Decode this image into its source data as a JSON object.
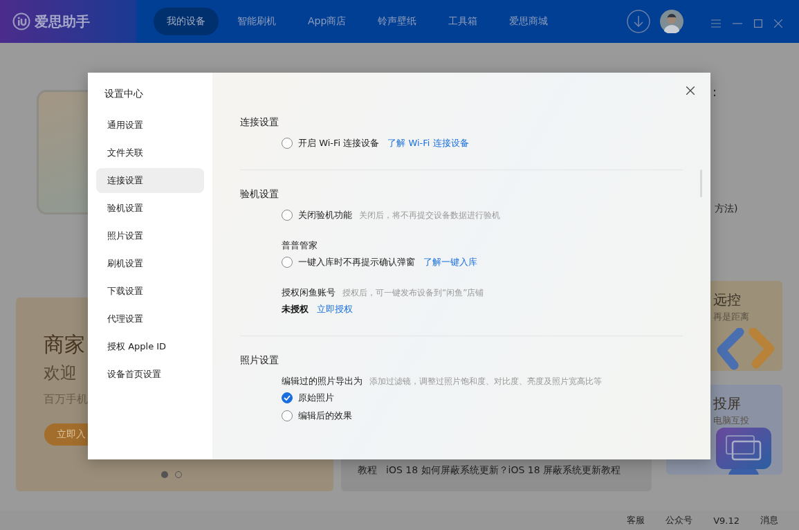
{
  "app": {
    "logo": "爱思助手",
    "nav": [
      {
        "label": "我的设备",
        "selected": true
      },
      {
        "label": "智能刷机",
        "selected": false
      },
      {
        "label": "App商店",
        "selected": false
      },
      {
        "label": "铃声壁纸",
        "selected": false
      },
      {
        "label": "工具箱",
        "selected": false
      },
      {
        "label": "爱思商城",
        "selected": false
      }
    ]
  },
  "background": {
    "device_panel": {
      "fragments": [
        ":",
        "方法)"
      ]
    },
    "promo_card": {
      "title": "商家",
      "subtitle": "欢迎",
      "text": "百万手机",
      "button": "立即入"
    },
    "tutorial_card": {
      "tag": "教程",
      "title": "iOS 18 如何屏蔽系统更新？iOS 18 屏蔽系统更新教程"
    },
    "side_cards": [
      {
        "kind": "remote",
        "title": "远控",
        "subtitle": "再是距离"
      },
      {
        "kind": "cast",
        "title": "投屏",
        "subtitle": "电脑互投"
      }
    ]
  },
  "dialog": {
    "title": "设置中心",
    "menu": [
      {
        "label": "通用设置",
        "selected": false
      },
      {
        "label": "文件关联",
        "selected": false
      },
      {
        "label": "连接设置",
        "selected": true
      },
      {
        "label": "验机设置",
        "selected": false
      },
      {
        "label": "照片设置",
        "selected": false
      },
      {
        "label": "刷机设置",
        "selected": false
      },
      {
        "label": "下载设置",
        "selected": false
      },
      {
        "label": "代理设置",
        "selected": false
      },
      {
        "label": "授权 Apple ID",
        "selected": false
      },
      {
        "label": "设备首页设置",
        "selected": false
      }
    ],
    "sections": [
      {
        "title": "连接设置",
        "items": [
          {
            "kind": "radio",
            "label": "开启 Wi-Fi 连接设备",
            "link": "了解 Wi-Fi 连接设备",
            "checked": false
          }
        ]
      },
      {
        "title": "验机设置",
        "items": [
          {
            "kind": "radio",
            "label": "关闭验机功能",
            "hint": "关闭后，将不再提交设备数据进行验机",
            "checked": false
          },
          {
            "kind": "subheading",
            "label": "普普管家"
          },
          {
            "kind": "radio",
            "label": "一键入库时不再提示确认弹窗",
            "link": "了解一键入库",
            "checked": false
          },
          {
            "kind": "subheading",
            "label": "授权闲鱼账号",
            "hint": "授权后，可一键发布设备到“闲鱼”店铺"
          },
          {
            "kind": "status",
            "label": "未授权",
            "link": "立即授权"
          }
        ]
      },
      {
        "title": "照片设置",
        "items": [
          {
            "kind": "subheading",
            "label": "编辑过的照片导出为",
            "hint": "添加过滤镜，调整过照片饱和度、对比度、亮度及照片宽高比等"
          },
          {
            "kind": "radio",
            "label": "原始照片",
            "checked": true
          },
          {
            "kind": "radio",
            "label": "编辑后的效果",
            "checked": false
          }
        ]
      }
    ]
  },
  "status_bar": [
    "客服",
    "公众号",
    "V9.12",
    "消息"
  ]
}
